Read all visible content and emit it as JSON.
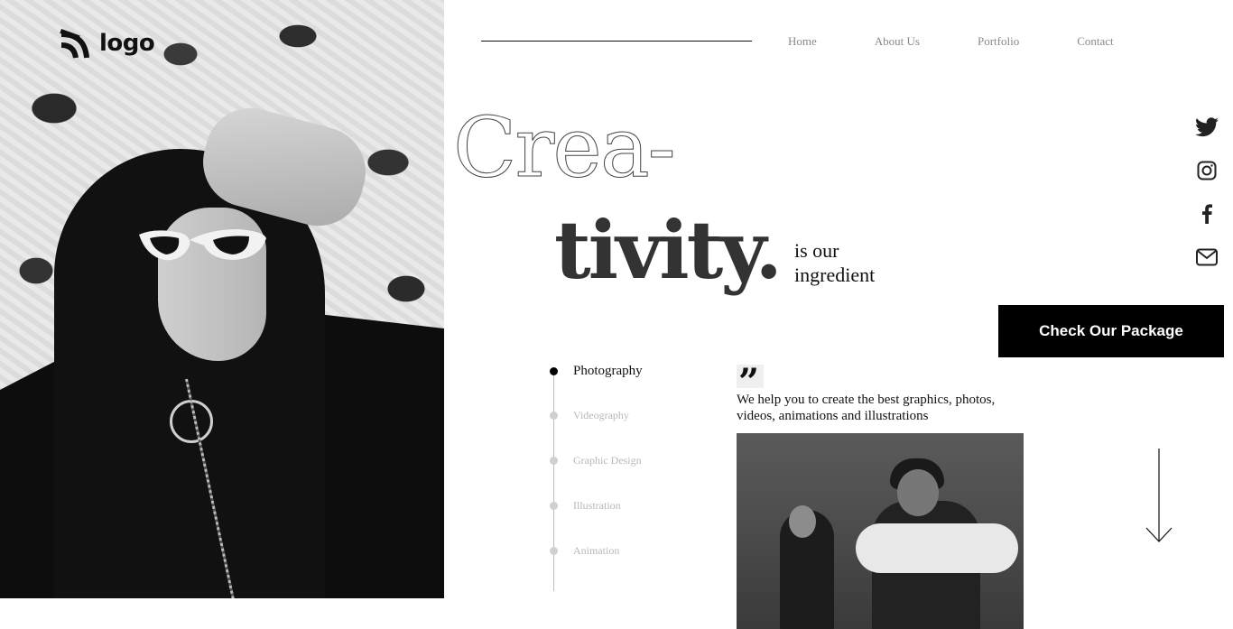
{
  "brand": {
    "logo_text": "logo"
  },
  "nav": {
    "items": [
      {
        "label": "Home"
      },
      {
        "label": "About Us"
      },
      {
        "label": "Portfolio"
      },
      {
        "label": "Contact"
      }
    ]
  },
  "hero": {
    "headline_outline": "Crea-",
    "headline_solid": "tivity.",
    "tagline": "is our ingredient",
    "cta_label": "Check Our Package"
  },
  "social": {
    "items": [
      {
        "icon": "twitter-icon"
      },
      {
        "icon": "instagram-icon"
      },
      {
        "icon": "facebook-icon"
      },
      {
        "icon": "mail-icon"
      }
    ]
  },
  "services": {
    "active_index": 0,
    "items": [
      {
        "label": "Photography"
      },
      {
        "label": "Videography"
      },
      {
        "label": "Graphic Design"
      },
      {
        "label": "Illustration"
      },
      {
        "label": "Animation"
      }
    ]
  },
  "quote": {
    "mark": "”",
    "text": "We help you to create the best graphics, photos, videos, animations and illustrations"
  },
  "colors": {
    "accent": "#000000",
    "muted": "#8a8a8a",
    "inactive": "#b8b8b8"
  }
}
